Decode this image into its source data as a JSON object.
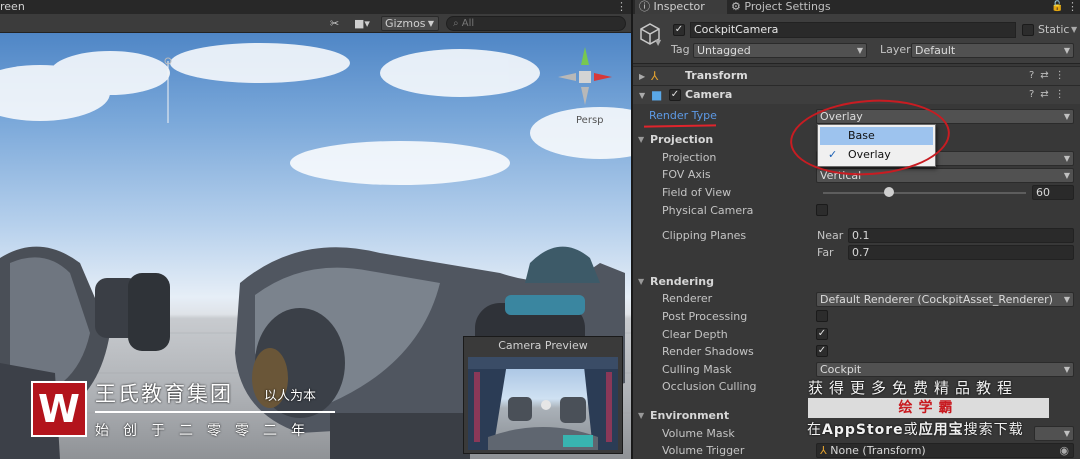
{
  "scene": {
    "tab_label": "reen",
    "gizmos_label": "Gizmos",
    "search_placeholder": "All",
    "persp_label": "Persp",
    "camera_preview_title": "Camera Preview"
  },
  "watermark": {
    "logo_letter": "W",
    "title": "王氏教育集团",
    "slogan": "以人为本",
    "subtitle": "始创于二零零二年"
  },
  "inspector": {
    "tabs": [
      {
        "label": "Inspector"
      },
      {
        "label": "Project Settings"
      }
    ],
    "object": {
      "name": "CockpitCamera",
      "static_label": "Static",
      "tag_label": "Tag",
      "tag_value": "Untagged",
      "layer_label": "Layer",
      "layer_value": "Default"
    },
    "transform": {
      "title": "Transform"
    },
    "camera": {
      "title": "Camera",
      "render_type_label": "Render Type",
      "render_type_value": "Overlay",
      "render_type_options": [
        "Base",
        "Overlay"
      ],
      "projection": {
        "section": "Projection",
        "projection_label": "Projection",
        "fov_axis_label": "FOV Axis",
        "fov_axis_value": "Vertical",
        "fov_label": "Field of View",
        "fov_value": "60",
        "physical_camera_label": "Physical Camera",
        "clipping_planes_label": "Clipping Planes",
        "near_label": "Near",
        "near_value": "0.1",
        "far_label": "Far",
        "far_value": "0.7"
      },
      "rendering": {
        "section": "Rendering",
        "renderer_label": "Renderer",
        "renderer_value": "Default Renderer (CockpitAsset_Renderer)",
        "post_processing_label": "Post Processing",
        "clear_depth_label": "Clear Depth",
        "render_shadows_label": "Render Shadows",
        "culling_mask_label": "Culling Mask",
        "culling_mask_value": "Cockpit",
        "occlusion_culling_label": "Occlusion Culling"
      },
      "environment": {
        "section": "Environment",
        "volume_mask_label": "Volume Mask",
        "volume_trigger_label": "Volume Trigger",
        "volume_trigger_value": "None (Transform)"
      }
    }
  },
  "promo": {
    "top": "获得更多免费精品教程",
    "brand": "绘学霸",
    "bottom_pre": "在",
    "bottom_store": "AppStore",
    "bottom_mid": "或",
    "bottom_app": "应用宝",
    "bottom_post": "搜索下载"
  },
  "colors": {
    "annotation_red": "#c81c22",
    "selection_blue": "#9dc3ee",
    "watermark_red": "#b3141c"
  }
}
